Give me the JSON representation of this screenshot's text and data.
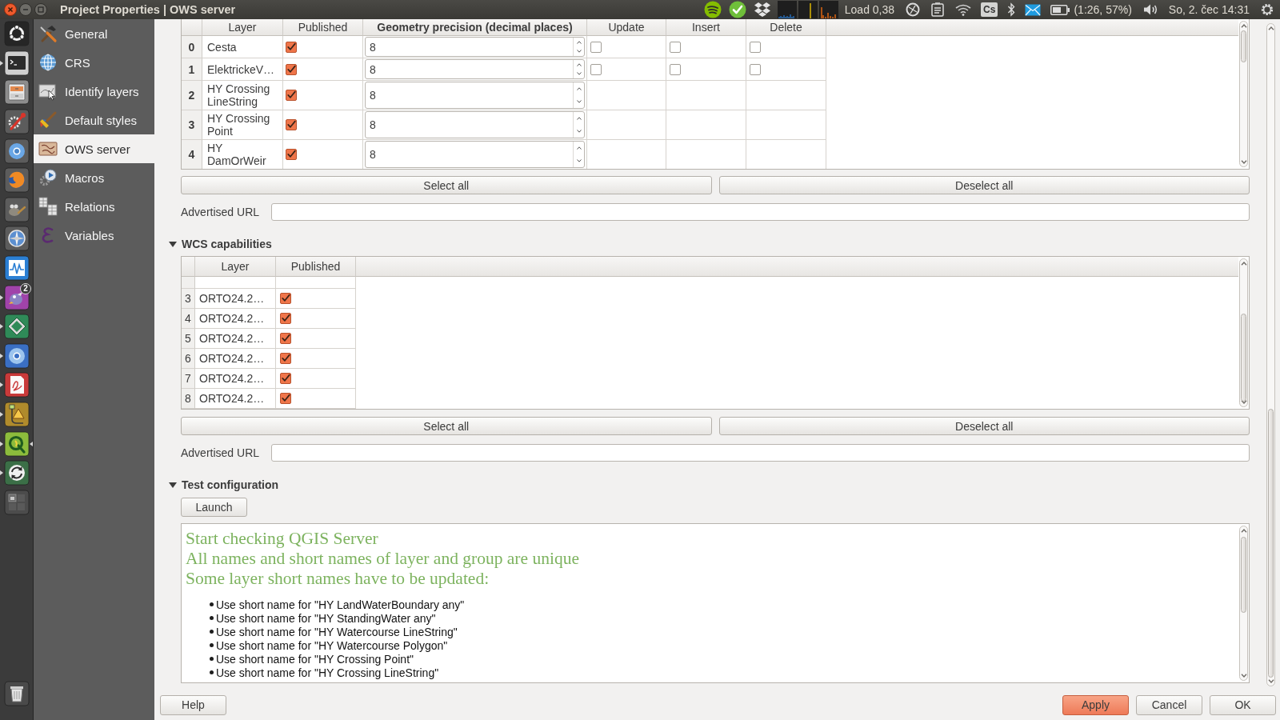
{
  "top_panel": {
    "window_title": "Project Properties | OWS server",
    "load": "Load 0,38",
    "keyboard_layout": "Cs",
    "battery": "(1:26, 57%)",
    "clock": "So, 2. čec 14:31"
  },
  "launcher": {
    "items": [
      {
        "running": false,
        "focused": false
      },
      {
        "running": true,
        "focused": false
      },
      {
        "running": false,
        "focused": false
      },
      {
        "running": false,
        "focused": false
      },
      {
        "running": false,
        "focused": false
      },
      {
        "running": false,
        "focused": false
      },
      {
        "running": false,
        "focused": false
      },
      {
        "running": false,
        "focused": false
      },
      {
        "running": false,
        "focused": false
      },
      {
        "running": true,
        "focused": false,
        "badge": "2"
      },
      {
        "running": true,
        "focused": false
      },
      {
        "running": true,
        "focused": false
      },
      {
        "running": true,
        "focused": false
      },
      {
        "running": true,
        "focused": false
      },
      {
        "running": true,
        "focused": true
      },
      {
        "running": true,
        "focused": false
      },
      {
        "running": false,
        "focused": false
      }
    ]
  },
  "sidebar": {
    "items": [
      {
        "label": "General",
        "selected": false
      },
      {
        "label": "CRS",
        "selected": false
      },
      {
        "label": "Identify layers",
        "selected": false
      },
      {
        "label": "Default styles",
        "selected": false
      },
      {
        "label": "OWS server",
        "selected": true
      },
      {
        "label": "Macros",
        "selected": false
      },
      {
        "label": "Relations",
        "selected": false
      },
      {
        "label": "Variables",
        "selected": false
      }
    ]
  },
  "wfs": {
    "columns": [
      {
        "label": "Layer",
        "selected": false
      },
      {
        "label": "Published",
        "selected": false
      },
      {
        "label": "Geometry precision (decimal places)",
        "selected": true
      },
      {
        "label": "Update",
        "selected": false
      },
      {
        "label": "Insert",
        "selected": false
      },
      {
        "label": "Delete",
        "selected": false
      }
    ],
    "rows": [
      {
        "index": "0",
        "layer": "Cesta",
        "published": true,
        "precision": "8",
        "selected": true,
        "edit": {
          "update": false,
          "insert": false,
          "delete": false
        }
      },
      {
        "index": "1",
        "layer": "ElektrickeV…",
        "published": true,
        "precision": "8",
        "selected": true,
        "edit": {
          "update": false,
          "insert": false,
          "delete": false
        }
      },
      {
        "index": "2",
        "layer": "HY Crossing LineString",
        "published": true,
        "precision": "8",
        "selected": true
      },
      {
        "index": "3",
        "layer": "HY Crossing Point",
        "published": true,
        "precision": "8",
        "selected": true
      },
      {
        "index": "4",
        "layer": "HY DamOrWeir",
        "published": true,
        "precision": "8",
        "selected": true
      }
    ],
    "select_all": "Select all",
    "deselect_all": "Deselect all",
    "url_label": "Advertised URL"
  },
  "wcs": {
    "title": "WCS capabilities",
    "expanded": true,
    "columns": [
      {
        "label": "Layer",
        "selected": false
      },
      {
        "label": "Published",
        "selected": false
      }
    ],
    "rows": [
      {
        "index": "3",
        "layer": "ORTO24.2…",
        "published": true,
        "selected": false
      },
      {
        "index": "4",
        "layer": "ORTO24.2…",
        "published": true,
        "selected": false
      },
      {
        "index": "5",
        "layer": "ORTO24.2…",
        "published": true,
        "selected": false
      },
      {
        "index": "6",
        "layer": "ORTO24.2…",
        "published": true,
        "selected": false
      },
      {
        "index": "7",
        "layer": "ORTO24.2…",
        "published": true,
        "selected": false
      },
      {
        "index": "8",
        "layer": "ORTO24.2…",
        "published": true,
        "selected": false
      }
    ],
    "select_all": "Select all",
    "deselect_all": "Deselect all",
    "url_label": "Advertised URL"
  },
  "test": {
    "title": "Test configuration",
    "expanded": true,
    "launch": "Launch",
    "messages": [
      "Start checking QGIS Server",
      "All names and short names of layer and group are unique",
      "Some layer short names have to be updated:"
    ],
    "items": [
      "Use short name for \"HY LandWaterBoundary any\"",
      "Use short name for \"HY StandingWater any\"",
      "Use short name for \"HY Watercourse LineString\"",
      "Use short name for \"HY Watercourse Polygon\"",
      "Use short name for \"HY Crossing Point\"",
      "Use short name for \"HY Crossing LineString\""
    ]
  },
  "footer": {
    "help": "Help",
    "buttons": [
      {
        "label": "Apply",
        "default": true
      },
      {
        "label": "Cancel",
        "default": false
      },
      {
        "label": "OK",
        "default": false
      }
    ]
  }
}
